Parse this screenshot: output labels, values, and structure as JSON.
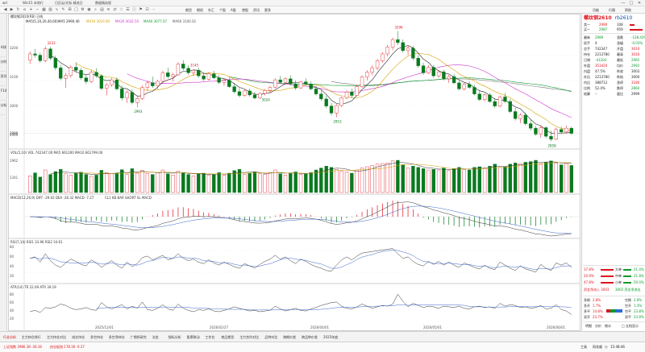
{
  "window": {
    "app_title": "wd",
    "menus": [
      "Win15 本地行",
      "日历云/光标 精选日",
      "数据精选版"
    ],
    "controls": [
      "—",
      "□",
      "✕"
    ]
  },
  "toolbar": {
    "items": [
      "期货",
      "期权",
      "外汇",
      "个股",
      "A股",
      "港股",
      "资讯",
      "更多"
    ],
    "right_links": [
      "功能",
      "行情",
      "帮助"
    ]
  },
  "left_tabs": [
    "K线",
    "分时",
    "资讯",
    "F10",
    "分析"
  ],
  "chart": {
    "header_text": "螺纹钢2610(RB) 日线",
    "ma_legend": [
      {
        "text": "MA5(5,10,20,40,60)",
        "color": "#222222"
      },
      {
        "text": "MA5 2990.40",
        "color": "#222222"
      },
      {
        "text": "MA10 3010.00",
        "color": "#d4a000"
      },
      {
        "text": "MA20 3032.50",
        "color": "#cc33cc"
      },
      {
        "text": "MA40 3077.07",
        "color": "#0a9a2a"
      },
      {
        "text": "MA60 3100.02",
        "color": "#555555"
      }
    ],
    "price_ticks": [
      "3200",
      "3100",
      "3000",
      "2900"
    ],
    "price_annotations": [
      {
        "text": "3233",
        "x_index": 4
      },
      {
        "text": "2993",
        "x_index": 21
      },
      {
        "text": "3145",
        "x_index": 32
      },
      {
        "text": "3024",
        "x_index": 46
      },
      {
        "text": "2953",
        "x_index": 60
      },
      {
        "text": "3296",
        "x_index": 72
      },
      {
        "text": "2858",
        "x_index": 102
      }
    ],
    "vol_legend": "VOL(5,10)  VOL 742347.00  MA5 661200  MA10 661799.00",
    "vol_ticks": [
      "1962",
      "1341"
    ],
    "macd_legend": "MACD(12,26,9)  DIFF -29.02  DEA -26.32  MACD -7.27",
    "macd_sub_legend": "CL1 KB BAR SHORT SL MACD",
    "rsi_legend": "RSI(7,14)  RSI1 33.96  RSI2 34.61",
    "rsi_ticks": [
      "80",
      "60",
      "40",
      "20"
    ],
    "atr_legend": "ATR(14)  TR 22.09  ATR 39.19",
    "atr_ticks": [
      "80",
      "60",
      "40",
      "20"
    ],
    "date_labels": [
      "2025/12/01",
      "2026/02/27",
      "2026/04/01",
      "2026/05/01",
      "2026/06/01"
    ],
    "last_price_label": "2989",
    "colors": {
      "up": "#e0141e",
      "down": "#0a7a1f",
      "ma5": "#222222",
      "ma10": "#d4a000",
      "ma20": "#cc33cc",
      "ma40": "#0a9a2a",
      "ma60": "#777777"
    }
  },
  "chart_data": {
    "type": "candlestick",
    "candles": [
      [
        3180,
        3215,
        3165,
        3205
      ],
      [
        3205,
        3225,
        3190,
        3200
      ],
      [
        3200,
        3210,
        3170,
        3178
      ],
      [
        3178,
        3235,
        3172,
        3225
      ],
      [
        3225,
        3233,
        3180,
        3188
      ],
      [
        3188,
        3198,
        3140,
        3150
      ],
      [
        3150,
        3162,
        3100,
        3108
      ],
      [
        3108,
        3130,
        3070,
        3120
      ],
      [
        3120,
        3160,
        3110,
        3152
      ],
      [
        3152,
        3172,
        3130,
        3140
      ],
      [
        3140,
        3150,
        3102,
        3110
      ],
      [
        3110,
        3122,
        3085,
        3095
      ],
      [
        3095,
        3140,
        3090,
        3132
      ],
      [
        3132,
        3148,
        3110,
        3118
      ],
      [
        3118,
        3125,
        3060,
        3068
      ],
      [
        3068,
        3090,
        3040,
        3082
      ],
      [
        3082,
        3110,
        3075,
        3102
      ],
      [
        3102,
        3112,
        3060,
        3066
      ],
      [
        3066,
        3078,
        3020,
        3030
      ],
      [
        3030,
        3060,
        3010,
        3052
      ],
      [
        3052,
        3065,
        3005,
        3012
      ],
      [
        3012,
        3035,
        2993,
        3028
      ],
      [
        3028,
        3080,
        3022,
        3072
      ],
      [
        3072,
        3098,
        3060,
        3090
      ],
      [
        3090,
        3115,
        3070,
        3078
      ],
      [
        3078,
        3102,
        3065,
        3096
      ],
      [
        3096,
        3138,
        3090,
        3130
      ],
      [
        3130,
        3150,
        3108,
        3115
      ],
      [
        3115,
        3130,
        3095,
        3122
      ],
      [
        3122,
        3172,
        3118,
        3165
      ],
      [
        3165,
        3180,
        3140,
        3148
      ],
      [
        3148,
        3160,
        3122,
        3130
      ],
      [
        3130,
        3145,
        3118,
        3140
      ],
      [
        3140,
        3150,
        3110,
        3118
      ],
      [
        3118,
        3130,
        3098,
        3105
      ],
      [
        3105,
        3132,
        3100,
        3126
      ],
      [
        3126,
        3138,
        3105,
        3110
      ],
      [
        3110,
        3120,
        3085,
        3092
      ],
      [
        3092,
        3108,
        3078,
        3100
      ],
      [
        3100,
        3112,
        3070,
        3075
      ],
      [
        3075,
        3090,
        3048,
        3055
      ],
      [
        3055,
        3070,
        3032,
        3040
      ],
      [
        3040,
        3062,
        3035,
        3058
      ],
      [
        3058,
        3068,
        3036,
        3042
      ],
      [
        3042,
        3055,
        3024,
        3030
      ],
      [
        3030,
        3052,
        3026,
        3048
      ],
      [
        3048,
        3066,
        3040,
        3060
      ],
      [
        3060,
        3078,
        3050,
        3072
      ],
      [
        3072,
        3108,
        3068,
        3102
      ],
      [
        3102,
        3118,
        3085,
        3092
      ],
      [
        3092,
        3112,
        3088,
        3106
      ],
      [
        3106,
        3120,
        3080,
        3086
      ],
      [
        3086,
        3100,
        3062,
        3070
      ],
      [
        3070,
        3098,
        3066,
        3094
      ],
      [
        3094,
        3108,
        3080,
        3085
      ],
      [
        3085,
        3096,
        3060,
        3066
      ],
      [
        3066,
        3078,
        3040,
        3046
      ],
      [
        3046,
        3060,
        3018,
        3026
      ],
      [
        3026,
        3040,
        2990,
        2998
      ],
      [
        2998,
        3010,
        2960,
        2970
      ],
      [
        2970,
        3005,
        2953,
        3000
      ],
      [
        3000,
        3035,
        2994,
        3030
      ],
      [
        3030,
        3060,
        3025,
        3054
      ],
      [
        3054,
        3068,
        3030,
        3040
      ],
      [
        3040,
        3080,
        3038,
        3075
      ],
      [
        3075,
        3120,
        3070,
        3114
      ],
      [
        3114,
        3140,
        3100,
        3132
      ],
      [
        3132,
        3160,
        3120,
        3150
      ],
      [
        3150,
        3185,
        3140,
        3178
      ],
      [
        3178,
        3212,
        3170,
        3205
      ],
      [
        3205,
        3240,
        3195,
        3232
      ],
      [
        3232,
        3270,
        3220,
        3262
      ],
      [
        3262,
        3296,
        3240,
        3250
      ],
      [
        3250,
        3262,
        3210,
        3218
      ],
      [
        3218,
        3238,
        3200,
        3228
      ],
      [
        3228,
        3236,
        3180,
        3188
      ],
      [
        3188,
        3200,
        3150,
        3158
      ],
      [
        3158,
        3170,
        3122,
        3130
      ],
      [
        3130,
        3160,
        3125,
        3152
      ],
      [
        3152,
        3160,
        3110,
        3118
      ],
      [
        3118,
        3140,
        3110,
        3134
      ],
      [
        3134,
        3142,
        3100,
        3106
      ],
      [
        3106,
        3122,
        3090,
        3115
      ],
      [
        3115,
        3125,
        3085,
        3090
      ],
      [
        3090,
        3100,
        3060,
        3066
      ],
      [
        3066,
        3090,
        3060,
        3084
      ],
      [
        3084,
        3096,
        3066,
        3072
      ],
      [
        3072,
        3082,
        3040,
        3046
      ],
      [
        3046,
        3062,
        3018,
        3024
      ],
      [
        3024,
        3048,
        3016,
        3042
      ],
      [
        3042,
        3050,
        3010,
        3016
      ],
      [
        3016,
        3030,
        2990,
        2998
      ],
      [
        2998,
        3040,
        2992,
        3034
      ],
      [
        3034,
        3050,
        3010,
        3016
      ],
      [
        3016,
        3026,
        2970,
        2976
      ],
      [
        2976,
        2990,
        2940,
        2948
      ],
      [
        2948,
        2970,
        2930,
        2962
      ],
      [
        2962,
        2972,
        2920,
        2928
      ],
      [
        2928,
        2945,
        2900,
        2910
      ],
      [
        2910,
        2920,
        2880,
        2886
      ],
      [
        2886,
        2920,
        2872,
        2912
      ],
      [
        2912,
        2918,
        2870,
        2878
      ],
      [
        2878,
        2900,
        2858,
        2866
      ],
      [
        2866,
        2912,
        2862,
        2905
      ],
      [
        2905,
        2916,
        2885,
        2895
      ],
      [
        2895,
        2920,
        2888,
        2910
      ],
      [
        2910,
        2916,
        2884,
        2889
      ]
    ],
    "volume": [
      520,
      610,
      480,
      700,
      560,
      650,
      720,
      580,
      540,
      600,
      630,
      560,
      500,
      540,
      690,
      620,
      580,
      600,
      710,
      560,
      740,
      600,
      680,
      590,
      560,
      620,
      700,
      580,
      540,
      660,
      620,
      560,
      520,
      580,
      600,
      540,
      560,
      620,
      540,
      600,
      680,
      720,
      560,
      600,
      640,
      580,
      560,
      620,
      700,
      580,
      540,
      600,
      640,
      560,
      580,
      620,
      700,
      760,
      820,
      780,
      720,
      660,
      640,
      600,
      700,
      760,
      800,
      840,
      880,
      900,
      920,
      980,
      1000,
      860,
      760,
      820,
      780,
      740,
      700,
      720,
      700,
      760,
      680,
      740,
      780,
      720,
      700,
      780,
      800,
      760,
      820,
      880,
      780,
      800,
      880,
      920,
      900,
      940,
      960,
      1000,
      880,
      940,
      980,
      920,
      860,
      900,
      840
    ],
    "rsi1": [
      58,
      62,
      48,
      70,
      52,
      40,
      34,
      46,
      56,
      50,
      42,
      38,
      54,
      46,
      34,
      44,
      52,
      40,
      32,
      48,
      36,
      44,
      60,
      64,
      54,
      60,
      66,
      54,
      58,
      70,
      58,
      52,
      56,
      48,
      44,
      54,
      46,
      40,
      48,
      42,
      36,
      32,
      44,
      38,
      32,
      42,
      50,
      56,
      66,
      56,
      62,
      52,
      44,
      56,
      50,
      42,
      36,
      32,
      26,
      24,
      40,
      54,
      62,
      54,
      64,
      72,
      74,
      76,
      78,
      80,
      82,
      84,
      70,
      58,
      62,
      50,
      42,
      38,
      50,
      42,
      50,
      40,
      48,
      40,
      34,
      46,
      40,
      34,
      30,
      40,
      32,
      28,
      48,
      40,
      32,
      26,
      38,
      30,
      26,
      22,
      42,
      32,
      26,
      46,
      40,
      46,
      34
    ],
    "atr": [
      30,
      34,
      28,
      42,
      40,
      44,
      52,
      48,
      40,
      36,
      38,
      42,
      36,
      34,
      56,
      44,
      38,
      44,
      50,
      38,
      46,
      40,
      58,
      36,
      34,
      40,
      50,
      38,
      34,
      52,
      40,
      34,
      30,
      36,
      34,
      38,
      32,
      30,
      34,
      38,
      44,
      40,
      36,
      32,
      34,
      30,
      32,
      34,
      46,
      38,
      32,
      36,
      40,
      34,
      32,
      38,
      42,
      48,
      52,
      56,
      58,
      46,
      40,
      38,
      44,
      52,
      46,
      40,
      44,
      48,
      46,
      52,
      80,
      60,
      44,
      54,
      48,
      42,
      46,
      44,
      40,
      46,
      44,
      42,
      46,
      40,
      38,
      44,
      46,
      42,
      44,
      40,
      54,
      46,
      50,
      48,
      42,
      44,
      40,
      42,
      48,
      38,
      40,
      50,
      36,
      32,
      22
    ]
  },
  "quote": {
    "title": "螺纹钢2610",
    "code": "rb2610",
    "sell_label": "卖一",
    "sell_price": "2990",
    "sell_vol": "108",
    "buy_label": "买一",
    "buy_price": "2987",
    "buy_vol": "959",
    "rows": [
      {
        "l": "最新",
        "lv": "2989",
        "lc": "grn",
        "r": "涨跌",
        "rv": "-128.43%",
        "rc": "grn"
      },
      {
        "l": "现手",
        "lv": "4",
        "lc": "blk",
        "r": "涨幅",
        "rv": "-0.03%",
        "rc": "grn"
      },
      {
        "l": "总手",
        "lv": "742347",
        "lc": "blk",
        "r": "开盘",
        "rv": "3010",
        "rc": "red"
      },
      {
        "l": "持仓",
        "lv": "2213780",
        "lc": "blk",
        "r": "最高",
        "rv": "3016",
        "rc": "red"
      },
      {
        "l": "日增",
        "lv": "-41204",
        "lc": "grn",
        "r": "最低",
        "rv": "2965",
        "rc": "grn"
      },
      {
        "l": "外盘",
        "lv": "353420",
        "lc": "red",
        "r": "均价",
        "rv": "2992",
        "rc": "grn"
      },
      {
        "l": "内盘",
        "lv": "47.5%",
        "lc": "blk",
        "r": "昨收",
        "rv": "3003",
        "rc": "blk"
      },
      {
        "l": "外比",
        "lv": "2213780",
        "lc": "blk",
        "r": "昨结",
        "rv": "3000",
        "rc": "blk"
      },
      {
        "l": "内比",
        "lv": "388712",
        "lc": "blk",
        "r": "涨停",
        "rv": "3180",
        "rc": "red"
      },
      {
        "l": "比例",
        "lv": "52.4%",
        "lc": "blk",
        "r": "跌停",
        "rv": "2860",
        "rc": "grn"
      },
      {
        "l": "结算",
        "lv": "--",
        "lc": "blk",
        "r": "量比",
        "rv": "2999",
        "rc": "blk"
      }
    ],
    "flow_rows": [
      {
        "l": "37.8%",
        "lab": "大单",
        "r": "21.4%"
      },
      {
        "l": "20.9%",
        "lab": "中单",
        "r": "21.8%"
      },
      {
        "l": "47.8%",
        "lab": "小单",
        "r": "50.4%"
      }
    ],
    "flow_summary_left": "资金净流入 3003",
    "flow_summary_right": "3002 资金净流出",
    "pos_rows": [
      {
        "l": "多换",
        "lv": "2.8%",
        "r": "空换",
        "rv": "2.8%"
      },
      {
        "l": "多开",
        "lv": "1.7%",
        "r": "空开",
        "rv": "1.3%"
      },
      {
        "l": "多平",
        "lv": "14.8%",
        "r": "空平",
        "rv": "23.8%"
      },
      {
        "l": "双开",
        "lv": "23.7%",
        "r": "双平",
        "rv": "23.8%"
      }
    ],
    "pos_bar_values": [
      0.25,
      0.3,
      0.45
    ],
    "bottom_tabs": [
      "明细",
      "分价",
      "统计"
    ],
    "bottom_check": "□ 五档显示"
  },
  "bottom": {
    "tabs": [
      "行业分析",
      "主力持仓排行",
      "主力持仓对比",
      "成交持仓",
      "多空持仓",
      "多空净持仓",
      "广期所研究",
      "冶金",
      "指标分析",
      "股票联动",
      "工作台",
      "商品期货",
      "主力合约对比",
      "品种对比",
      "跨期价差",
      "跨品种价差",
      "2025年度"
    ],
    "status_left": "上证指数 3986.38  -36.16",
    "status_mid": "创业板指 178.36  -0.37",
    "status_right_clock": "15:48:46",
    "status_right_links": [
      "工具",
      "同花顺"
    ]
  }
}
